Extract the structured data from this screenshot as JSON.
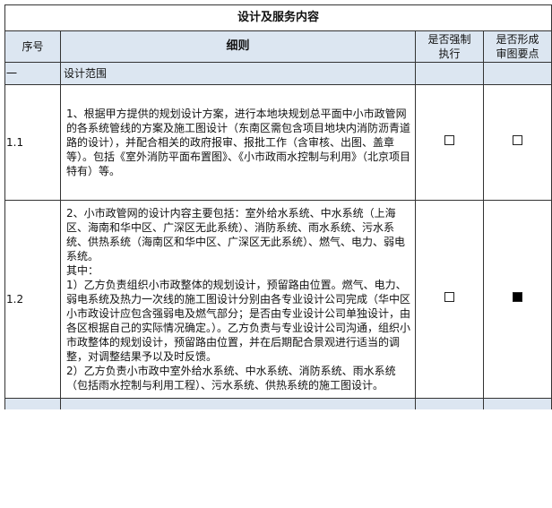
{
  "table": {
    "title": "设计及服务内容",
    "headers": {
      "no": "序号",
      "detail": "细则",
      "mandatory": "是否强制\n执行",
      "review": "是否形成\n审图要点"
    },
    "section": {
      "no": "一",
      "label": "设计范围"
    },
    "rows": [
      {
        "no": "1.1",
        "text": "1、根据甲方提供的规划设计方案，进行本地块规划总平面中小市政管网的各系统管线的方案及施工图设计（东南区需包含项目地块内消防沥青道路的设计），并配合相关的政府报审、报批工作（含审核、出图、盖章等）。包括《室外消防平面布置图》、《小市政雨水控制与利用》（北京项目特有）等。",
        "mandatory": false,
        "review": false
      },
      {
        "no": "1.2",
        "text": "2、小市政管网的设计内容主要包括：室外给水系统、中水系统（上海区、海南和华中区、广深区无此系统）、消防系统、雨水系统、污水系统、供热系统（海南区和华中区、广深区无此系统）、燃气、电力、弱电系统。\n其中：\n1）乙方负责组织小市政整体的规划设计，预留路由位置。燃气、电力、弱电系统及热力一次线的施工图设计分别由各专业设计公司完成（华中区小市政设计应包含强弱电及燃气部分；是否由专业设计公司单独设计，由各区根据自己的实际情况确定。）。乙方负责与专业设计公司沟通，组织小市政整体的规划设计，预留路由位置，并在后期配合景观进行适当的调整，对调整结果予以及时反馈。\n2）乙方负责小市政中室外给水系统、中水系统、消防系统、雨水系统（包括雨水控制与利用工程）、污水系统、供热系统的施工图设计。",
        "mandatory": false,
        "review": true
      }
    ]
  }
}
